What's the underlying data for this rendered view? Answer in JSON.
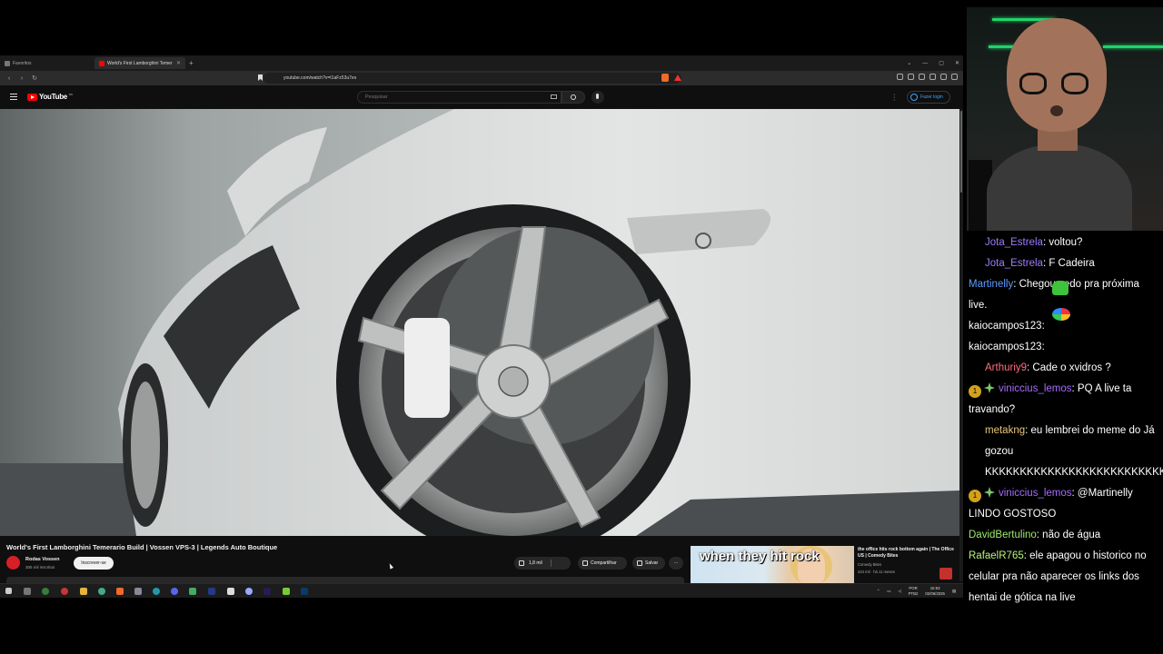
{
  "browser": {
    "tabs": [
      {
        "label": "Favoritos",
        "active": false
      },
      {
        "label": "World's First Lamborghini Temer",
        "active": true
      }
    ],
    "url": "youtube.com/watch?v=t1aFz53u7es"
  },
  "youtube": {
    "logo": "YouTube",
    "country": "BR",
    "search_placeholder": "Pesquisar",
    "signin_label": "Fazer login"
  },
  "video": {
    "title": "World's First Lamborghini Temerario Build | Vossen VPS-3 | Legends Auto Boutique",
    "channel": "Rodas Vossen",
    "subscribers": "305 mil inscritos",
    "subscribe_label": "Inscrever-se",
    "likes": "1,8 mil",
    "share_label": "Compartilhar",
    "save_label": "Salvar"
  },
  "recommended": {
    "thumb_text": "when they hit rock",
    "title": "the office hits rock bottom again | The Office US | Comedy Bites",
    "channel": "Comedy Bites",
    "meta": "424 mil · há 11 meses"
  },
  "taskbar": {
    "lang_top": "POR",
    "lang_bottom": "PTB2",
    "time": "15:53",
    "date": "02/06/2025"
  },
  "chat": [
    {
      "user": "Jota_Estrela",
      "color": "#9b7cff",
      "text": ": voltou?",
      "indent": true
    },
    {
      "user": "Jota_Estrela",
      "color": "#9b7cff",
      "text": ": F Cadeira",
      "indent": true
    },
    {
      "user": "Martinelly",
      "color": "#5b9dff",
      "text": ": Chegou cedo pra próxima live.",
      "indent": false
    },
    {
      "user": "kaiocampos123",
      "color": "#ffffff",
      "text": ":",
      "indent": false
    },
    {
      "user": "kaiocampos123",
      "color": "#ffffff",
      "text": ":",
      "indent": false
    },
    {
      "user": "Arthuriy9",
      "color": "#ff6f7d",
      "text": ": Cade o xvidros ?",
      "indent": true
    },
    {
      "user": "viniccius_lemos",
      "color": "#a46cff",
      "text": ": PQ A live ta travando?",
      "indent": false,
      "badges": true
    },
    {
      "user": "metakng",
      "color": "#e8c77a",
      "text": ": eu lembrei do meme do Já gozou KKKKKKKKKKKKKKKKKKKKKKKKKKKKKK",
      "indent": true
    },
    {
      "user": "viniccius_lemos",
      "color": "#a46cff",
      "text": ": @Martinelly LINDO GOSTOSO",
      "indent": false,
      "badges": true
    },
    {
      "user": "DavidBertulino",
      "color": "#9fe870",
      "text": ": não de água",
      "indent": false
    },
    {
      "user": "RafaelR765",
      "color": "#b9f27a",
      "text": ": ele apagou o historico no celular pra não aparecer os links dos hentai de gótica na live",
      "indent": false
    }
  ],
  "colors": {
    "youtube_red": "#ff0000",
    "link_blue": "#3ea6ff",
    "shelf_green": "#1fd46b"
  },
  "icons": [
    "bookmark-icon",
    "search-icon",
    "mic-icon",
    "keyboard-icon",
    "menu-icon",
    "user-icon",
    "like-icon",
    "dislike-icon",
    "share-icon",
    "save-icon",
    "more-icon"
  ]
}
